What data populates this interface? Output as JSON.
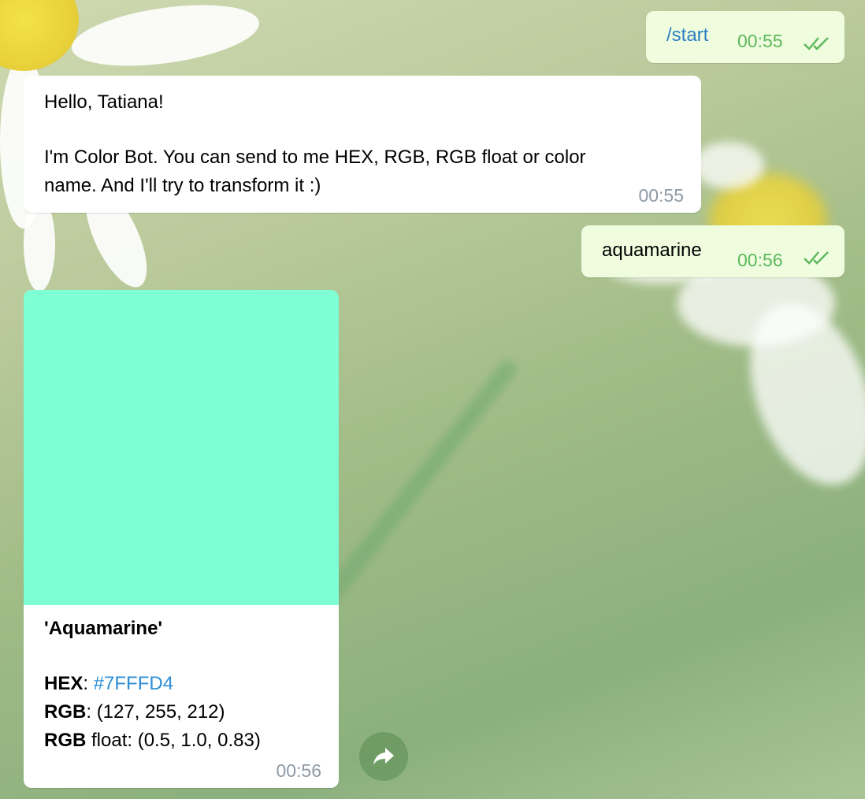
{
  "messages": {
    "start": {
      "text": "/start",
      "time": "00:55"
    },
    "greeting": {
      "line1": "Hello, Tatiana!",
      "line2": "I'm Color Bot. You can send to me HEX, RGB, RGB float or color",
      "line3": "name. And I'll try to transform it :)",
      "time": "00:55"
    },
    "query": {
      "text": "aquamarine",
      "time": "00:56"
    },
    "result": {
      "swatch_color": "#7FFFD4",
      "name": "'Aquamarine'",
      "hex_label": "HEX",
      "hex_value": "#7FFFD4",
      "rgb_label": "RGB",
      "rgb_value": "(127, 255, 212)",
      "rgbf_label_bold": "RGB",
      "rgbf_label_rest": " float",
      "rgbf_value": "(0.5, 1.0, 0.83)",
      "time": "00:56"
    }
  },
  "icons": {
    "forward": "forward-arrow-icon",
    "read": "double-check-icon"
  },
  "colors": {
    "outgoing_bubble": "#effdde",
    "incoming_bubble": "#ffffff",
    "read_check": "#5cb85c",
    "link": "#2d8fd5"
  }
}
